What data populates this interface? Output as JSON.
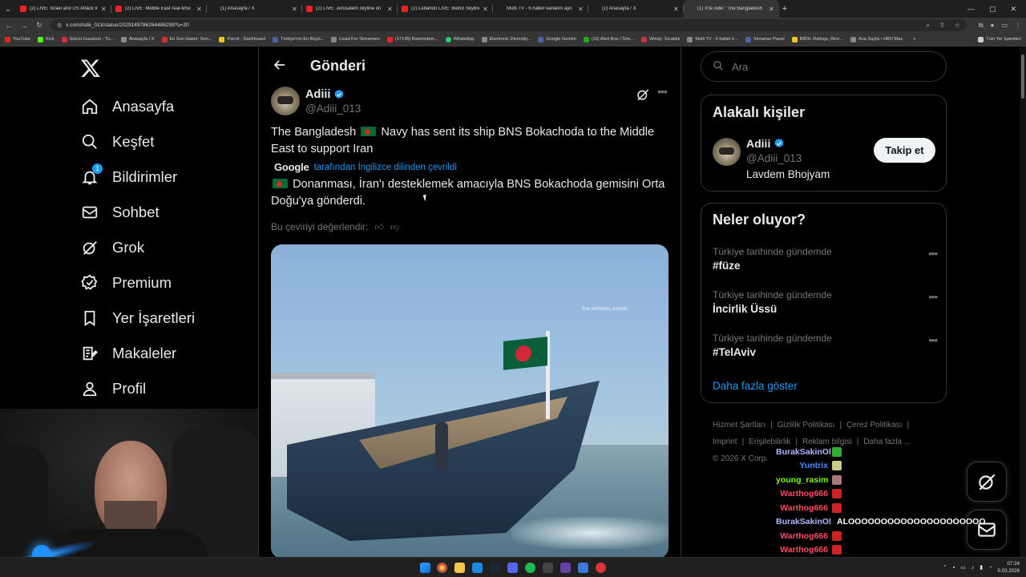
{
  "browser": {
    "tabs": [
      {
        "title": "(2) LIVE: Israel and US Attack Ir",
        "icon": "youtube-icon",
        "active": false
      },
      {
        "title": "(2) LIVE: Middle East real-time",
        "icon": "youtube-icon",
        "active": false
      },
      {
        "title": "(1) Anasayfa / X",
        "icon": "x-icon",
        "active": false
      },
      {
        "title": "(2) LIVE: Jerusalem skyline on",
        "icon": "youtube-icon",
        "active": false
      },
      {
        "title": "(2) Lebanon LIVE: Beirut Skyline",
        "icon": "youtube-icon",
        "active": false
      },
      {
        "title": "Multi TV - 6 haber kanalını ayn",
        "icon": "blank-icon",
        "active": false
      },
      {
        "title": "(1) Anasayfa / X",
        "icon": "x-icon",
        "active": false
      },
      {
        "title": "(1) X'te Adiii: \"The Bangladesh",
        "icon": "x-icon",
        "active": true
      }
    ],
    "url": "x.com/Adiii_013/status/2029149786264486299?s=20",
    "bookmarks": [
      {
        "label": "YouTube",
        "color": "yt"
      },
      {
        "label": "Kick",
        "color": "kick"
      },
      {
        "label": "Sözcü Gazetesi - Tü...",
        "color": "red"
      },
      {
        "label": "Anasayfa / X",
        "color": "x"
      },
      {
        "label": "En Son Haber: Son...",
        "color": "red"
      },
      {
        "label": "Parrot - Dashboard",
        "color": "yel"
      },
      {
        "label": "Türkiye'nin En Büyü...",
        "color": "blu"
      },
      {
        "label": "Livad For Streamers",
        "color": "grey"
      },
      {
        "label": "(17145) Rammstein...",
        "color": "yt"
      },
      {
        "label": "WhatsApp",
        "color": "wa"
      },
      {
        "label": "Electronic Diversity...",
        "color": "grey"
      },
      {
        "label": "Google Gemini",
        "color": "blu"
      },
      {
        "label": "(19) Alert Box / Stre...",
        "color": "grn"
      },
      {
        "label": "Windy: Sıcaklık",
        "color": "red"
      },
      {
        "label": "Multi TV - 6 haber k...",
        "color": "grey"
      },
      {
        "label": "Streamer Panel",
        "color": "blu"
      },
      {
        "label": "IMDb: Ratings, Revi...",
        "color": "yel"
      },
      {
        "label": "Ana Sayfa • HBO Max",
        "color": "grey"
      }
    ],
    "all_bookmarks": "Tüm Yer İşaretleri"
  },
  "sidebar": {
    "items": [
      {
        "label": "Anasayfa",
        "icon": "home-icon"
      },
      {
        "label": "Keşfet",
        "icon": "search-icon"
      },
      {
        "label": "Bildirimler",
        "icon": "bell-icon",
        "badge": "1"
      },
      {
        "label": "Sohbet",
        "icon": "mail-icon"
      },
      {
        "label": "Grok",
        "icon": "grok-icon"
      },
      {
        "label": "Premium",
        "icon": "premium-icon"
      },
      {
        "label": "Yer İşaretleri",
        "icon": "bookmark-icon"
      },
      {
        "label": "Makaleler",
        "icon": "article-icon"
      },
      {
        "label": "Profil",
        "icon": "profile-icon"
      }
    ]
  },
  "post": {
    "header_title": "Gönderi",
    "author_name": "Adiii",
    "author_handle": "@Adiii_013",
    "text_en_part1": "The Bangladesh",
    "text_en_part2": "Navy has sent its ship BNS Bokachoda to the Middle East to support Iran",
    "translated_by_brand": "Google",
    "translated_by_text": "tarafından İngilizce dilinden çevrildi",
    "text_tr": "Donanması, İran'ı desteklemek amacıyla BNS Bokachoda gemisini Orta Doğu'ya gönderdi.",
    "rate_translation": "Bu çeviriyi değerlendir:",
    "media_watermark": "THE NATIONAL RADAR"
  },
  "search": {
    "placeholder": "Ara"
  },
  "related": {
    "title": "Alakalı kişiler",
    "name": "Adiii",
    "handle": "@Adiii_013",
    "bio": "Lavdem Bhojyam",
    "follow_label": "Takip et"
  },
  "trends": {
    "title": "Neler oluyor?",
    "items": [
      {
        "context": "Türkiye tarihinde gündemde",
        "name": "#füze"
      },
      {
        "context": "Türkiye tarihinde gündemde",
        "name": "İncirlik Üssü"
      },
      {
        "context": "Türkiye tarihinde gündemde",
        "name": "#TelAviv"
      }
    ],
    "show_more": "Daha fazla göster"
  },
  "footer": {
    "links": [
      "Hizmet Şartları",
      "|",
      "Gizlilik Politikası",
      "|",
      "Çerez Politikası",
      "|"
    ],
    "links2": [
      "Imprint",
      "|",
      "Erişilebilirlik",
      "|",
      "Reklam bilgisi",
      "|",
      "Daha fazla ..."
    ],
    "copyright": "© 2026 X Corp."
  },
  "chat": [
    {
      "user": "BurakSakinOl",
      "color": "#aeb8ff",
      "badge": "#3a3",
      "text": ""
    },
    {
      "user": "Yuntrix",
      "color": "#4f8cff",
      "badge": "#cc8",
      "text": ""
    },
    {
      "user": "young_rasim",
      "color": "#7cfc00",
      "badge": "#a77",
      "text": ""
    },
    {
      "user": "Warthog666",
      "color": "#ff4a5e",
      "badge": "#c22",
      "text": ""
    },
    {
      "user": "Warthog666",
      "color": "#ff4a5e",
      "badge": "#c22",
      "text": ""
    },
    {
      "user": "BurakSakinOl",
      "color": "#aeb8ff",
      "badge": "",
      "text": "ALOOOOOOOOOOOOOOOOOOOOO"
    },
    {
      "user": "Warthog666",
      "color": "#ff4a5e",
      "badge": "#c22",
      "text": ""
    },
    {
      "user": "Warthog666",
      "color": "#ff4a5e",
      "badge": "#c22",
      "text": ""
    },
    {
      "user": "BurakSakinOl",
      "color": "#aeb8ff",
      "badge": "#c22",
      "text": ""
    }
  ],
  "taskbar": {
    "time": "07:24",
    "date": "5.03.2026"
  },
  "colors": {
    "accent": "#1d9bf0",
    "bg": "#000000",
    "border": "#2f3336",
    "muted": "#71767b"
  }
}
